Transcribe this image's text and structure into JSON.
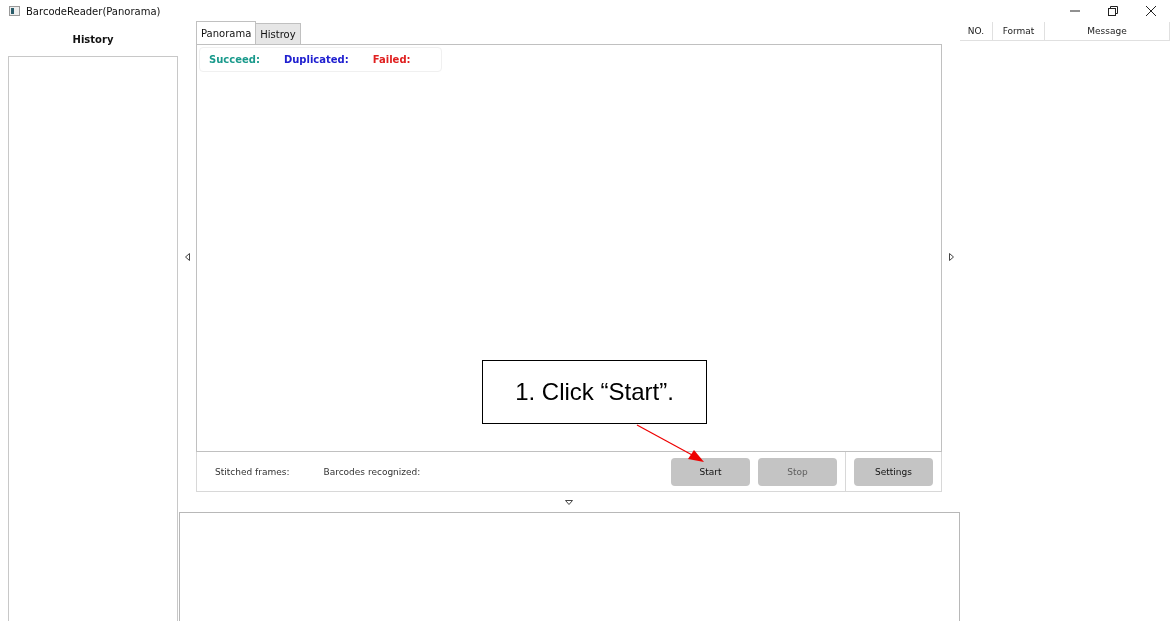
{
  "window": {
    "title": "BarcodeReader(Panorama)"
  },
  "history": {
    "title": "History"
  },
  "tabs": [
    {
      "label": "Panorama",
      "selected": true
    },
    {
      "label": "Histroy",
      "selected": false
    }
  ],
  "legend": [
    {
      "label": "Succeed:",
      "color": "#1a9a8c"
    },
    {
      "label": "Duplicated:",
      "color": "#2020d0"
    },
    {
      "label": "Failed:",
      "color": "#e02020"
    }
  ],
  "stats": [
    "Stitched frames:",
    "Barcodes recognized:"
  ],
  "buttons": [
    {
      "label": "Start",
      "disabled": false
    },
    {
      "label": "Stop",
      "disabled": true
    }
  ],
  "settings_button": {
    "label": "Settings",
    "disabled": false
  },
  "table": {
    "columns": [
      "NO.",
      "Format",
      "Message"
    ]
  },
  "callout": {
    "text": "1. Click “Start”."
  }
}
